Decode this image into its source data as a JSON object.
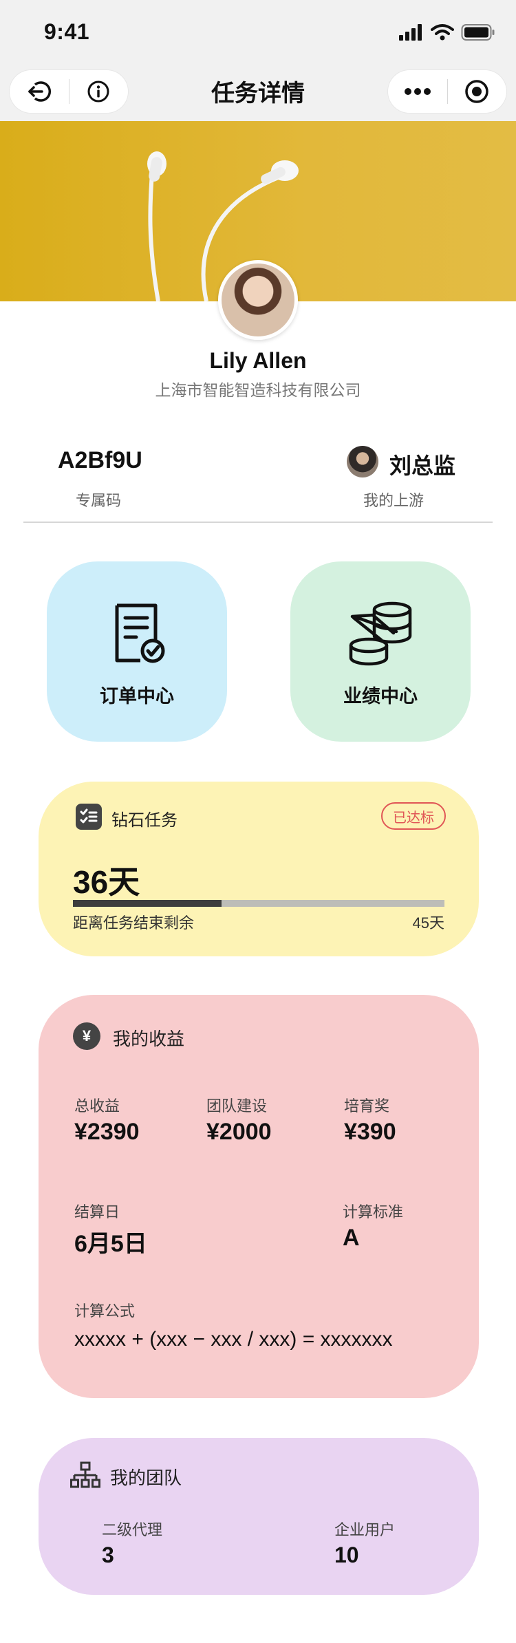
{
  "status_bar": {
    "time": "9:41"
  },
  "nav": {
    "title": "任务详情"
  },
  "profile": {
    "name": "Lily Allen",
    "company": "上海市智能智造科技有限公司"
  },
  "code": {
    "value": "A2Bf9U",
    "label": "专属码"
  },
  "upstream": {
    "name": "刘总监",
    "label": "我的上游"
  },
  "tiles": [
    {
      "label": "订单中心",
      "icon": "document-check-icon",
      "color": "#cdeefa"
    },
    {
      "label": "业绩中心",
      "icon": "coins-stack-icon",
      "color": "#d4f1df"
    }
  ],
  "diamond_task": {
    "title": "钻石任务",
    "badge": "已达标",
    "remaining_days": "36天",
    "remaining_label": "距离任务结束剩余",
    "total_days": "45天",
    "progress_fraction": 0.4,
    "color": "#fdf3b5"
  },
  "earnings": {
    "icon_text": "¥",
    "title": "我的收益",
    "total_label": "总收益",
    "total_value": "¥2390",
    "team_build_label": "团队建设",
    "team_build_value": "¥2000",
    "training_label": "培育奖",
    "training_value": "¥390",
    "settle_label": "结算日",
    "settle_value": "6月5日",
    "standard_label": "计算标准",
    "standard_value": "A",
    "formula_label": "计算公式",
    "formula_value": "xxxxx + (xxx − xxx / xxx) = xxxxxxx",
    "color": "#f8cccd"
  },
  "team": {
    "title": "我的团队",
    "agent_label": "二级代理",
    "agent_value": "3",
    "enterprise_label": "企业用户",
    "enterprise_value": "10",
    "color": "#e9d4f2"
  },
  "colors": {
    "hero": "#dcb22a",
    "badge": "#e05656"
  }
}
